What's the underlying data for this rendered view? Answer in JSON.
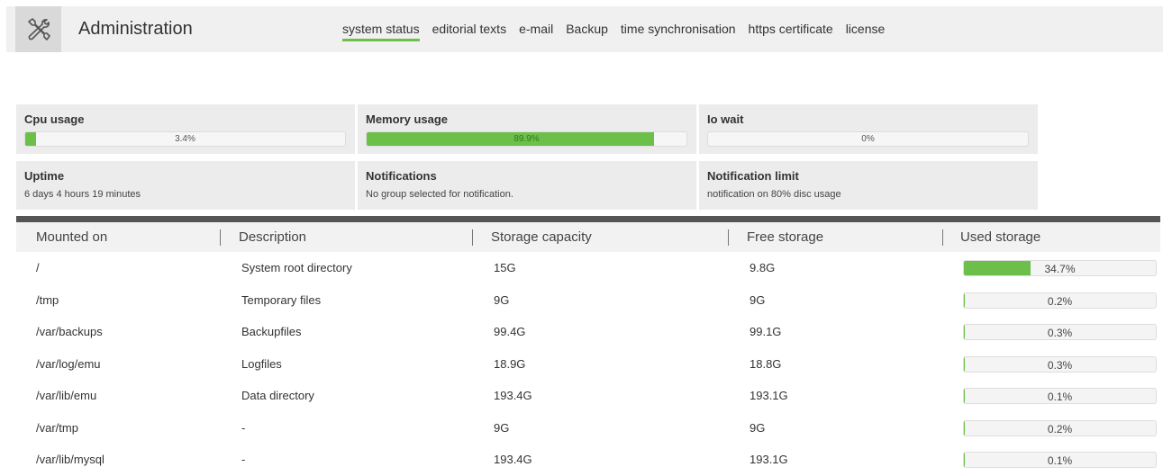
{
  "header": {
    "icon": "tools-icon",
    "title": "Administration",
    "nav": [
      {
        "label": "system status",
        "active": true
      },
      {
        "label": "editorial texts",
        "active": false
      },
      {
        "label": "e-mail",
        "active": false
      },
      {
        "label": "Backup",
        "active": false
      },
      {
        "label": "time synchronisation",
        "active": false
      },
      {
        "label": "https certificate",
        "active": false
      },
      {
        "label": "license",
        "active": false
      }
    ]
  },
  "stats": {
    "cpu": {
      "title": "Cpu usage",
      "value_label": "3.4%",
      "fraction": 0.034
    },
    "memory": {
      "title": "Memory usage",
      "value_label": "89.9%",
      "fraction": 0.899
    },
    "io": {
      "title": "Io wait",
      "value_label": "0%",
      "fraction": 0
    },
    "uptime": {
      "title": "Uptime",
      "text": "6 days 4 hours 19 minutes"
    },
    "notifications": {
      "title": "Notifications",
      "text": "No group selected for notification."
    },
    "limit": {
      "title": "Notification limit",
      "text": "notification on 80% disc usage"
    }
  },
  "accent_color": "#6cc04a",
  "table": {
    "headers": [
      "Mounted on",
      "Description",
      "Storage capacity",
      "Free storage",
      "Used storage"
    ],
    "rows": [
      {
        "mount": "/",
        "description": "System root directory",
        "capacity": "15G",
        "free": "9.8G",
        "used_label": "34.7%",
        "used": 0.347
      },
      {
        "mount": "/tmp",
        "description": "Temporary files",
        "capacity": "9G",
        "free": "9G",
        "used_label": "0.2%",
        "used": 0.002
      },
      {
        "mount": "/var/backups",
        "description": "Backupfiles",
        "capacity": "99.4G",
        "free": "99.1G",
        "used_label": "0.3%",
        "used": 0.003
      },
      {
        "mount": "/var/log/emu",
        "description": "Logfiles",
        "capacity": "18.9G",
        "free": "18.8G",
        "used_label": "0.3%",
        "used": 0.003
      },
      {
        "mount": "/var/lib/emu",
        "description": "Data directory",
        "capacity": "193.4G",
        "free": "193.1G",
        "used_label": "0.1%",
        "used": 0.001
      },
      {
        "mount": "/var/tmp",
        "description": "-",
        "capacity": "9G",
        "free": "9G",
        "used_label": "0.2%",
        "used": 0.002
      },
      {
        "mount": "/var/lib/mysql",
        "description": "-",
        "capacity": "193.4G",
        "free": "193.1G",
        "used_label": "0.1%",
        "used": 0.001
      }
    ]
  }
}
